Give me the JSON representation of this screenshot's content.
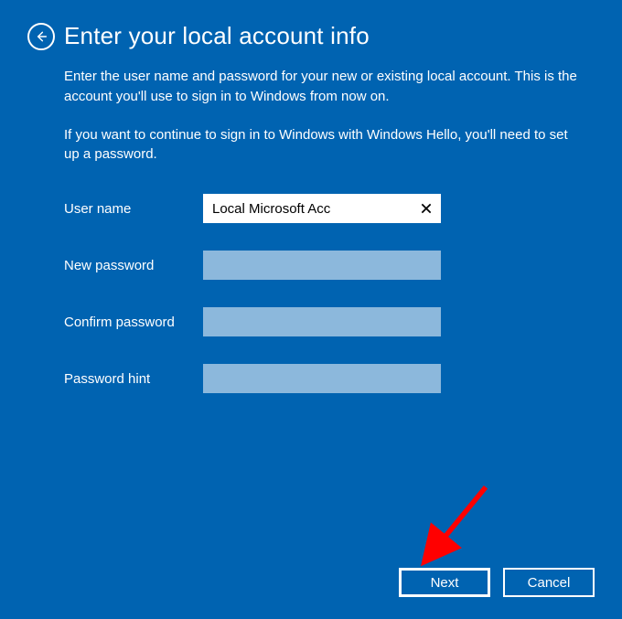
{
  "header": {
    "title": "Enter your local account info"
  },
  "description": {
    "paragraph1": "Enter the user name and password for your new or existing local account. This is the account you'll use to sign in to Windows from now on.",
    "paragraph2": "If you want to continue to sign in to Windows with Windows Hello, you'll need to set up a password."
  },
  "form": {
    "username": {
      "label": "User name",
      "value": "Local Microsoft Acc"
    },
    "new_password": {
      "label": "New password",
      "value": ""
    },
    "confirm_password": {
      "label": "Confirm password",
      "value": ""
    },
    "password_hint": {
      "label": "Password hint",
      "value": ""
    }
  },
  "buttons": {
    "next": "Next",
    "cancel": "Cancel"
  }
}
